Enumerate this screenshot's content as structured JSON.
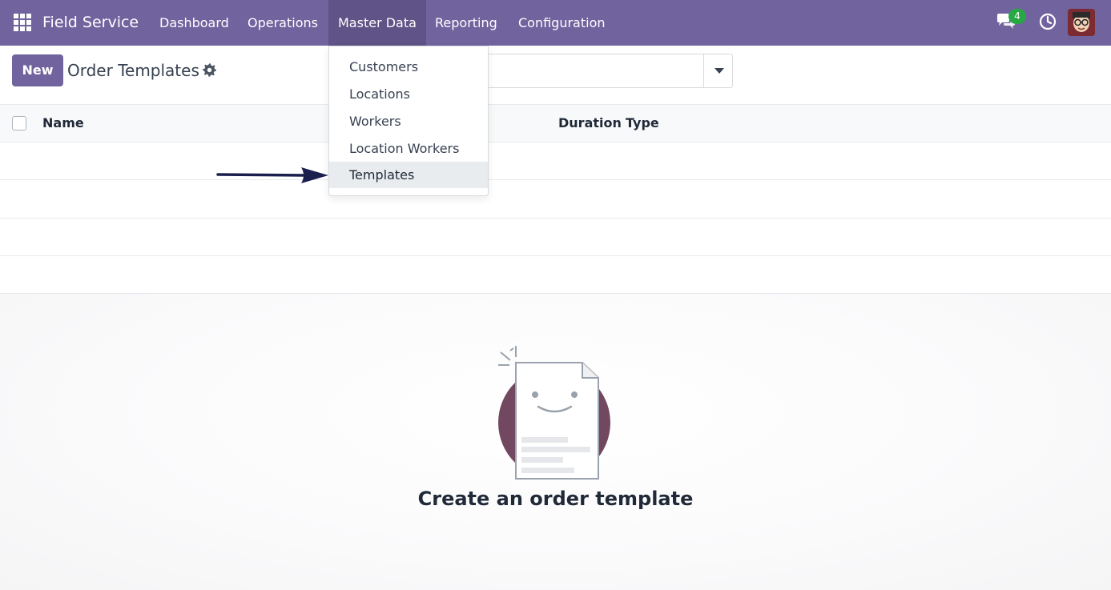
{
  "navbar": {
    "brand": "Field Service",
    "menu": [
      "Dashboard",
      "Operations",
      "Master Data",
      "Reporting",
      "Configuration"
    ],
    "active_menu": "Master Data",
    "chat_count": "4",
    "icons": [
      "apps-grid-icon",
      "chat-icon",
      "clock-icon",
      "avatar"
    ]
  },
  "control_panel": {
    "new_label": "New",
    "title": "Order Templates",
    "gear_icon": "gear-icon",
    "search_value": ""
  },
  "table": {
    "columns": [
      "Name",
      "Duration",
      "Type"
    ],
    "rows": []
  },
  "dropdown": {
    "items": [
      "Customers",
      "Locations",
      "Workers",
      "Location Workers",
      "Templates"
    ],
    "highlighted": "Templates"
  },
  "empty_state": {
    "title": "Create an order template"
  },
  "colors": {
    "navbar": "#71639e",
    "navbar_active": "#5f5387",
    "badge": "#28a745",
    "primary_button": "#71639e"
  }
}
